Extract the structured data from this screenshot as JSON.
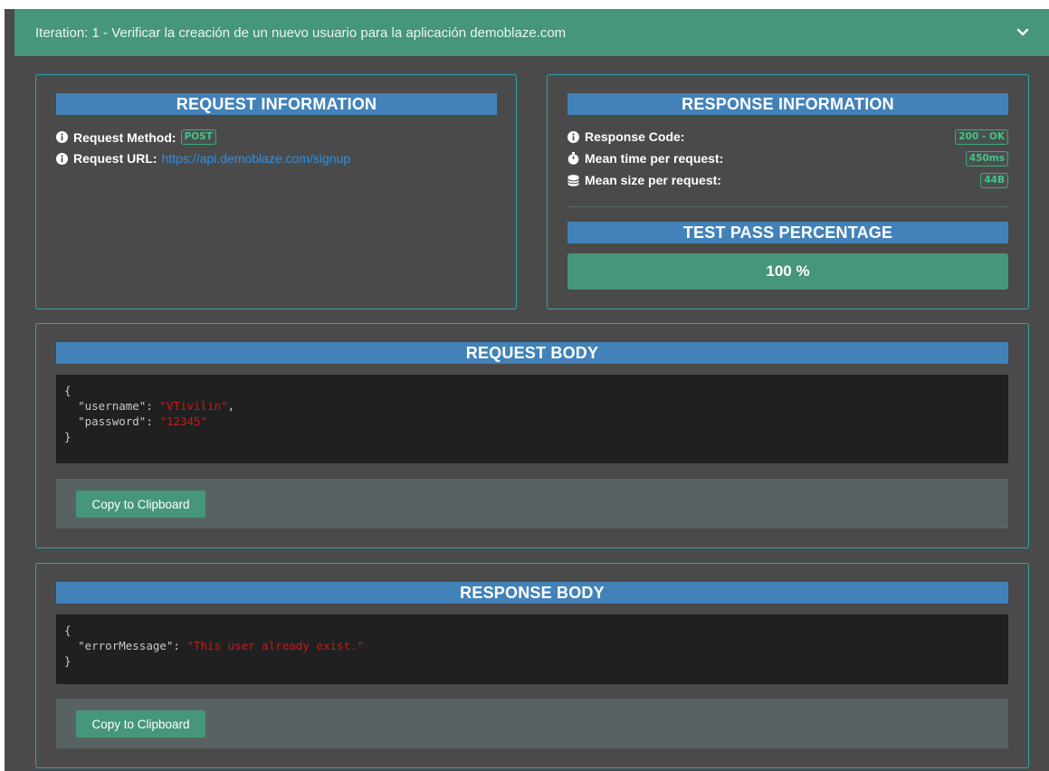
{
  "iteration": {
    "title": "Iteration: 1 - Verificar la creación de un nuevo usuario para la aplicación demoblaze.com",
    "toggle_icon": "chevron-down-icon"
  },
  "request_info": {
    "heading": "REQUEST INFORMATION",
    "method_label": "Request Method:",
    "method_value": "POST",
    "url_label": "Request URL:",
    "url_value": "https://api.demoblaze.com/signup"
  },
  "response_info": {
    "heading": "RESPONSE INFORMATION",
    "code_label": "Response Code:",
    "code_value": "200 - OK",
    "time_label": "Mean time per request:",
    "time_value": "450ms",
    "size_label": "Mean size per request:",
    "size_value": "44B"
  },
  "pass": {
    "heading": "TEST PASS PERCENTAGE",
    "value_text": "100 %",
    "percent": 100
  },
  "request_body": {
    "heading": "REQUEST BODY",
    "open": "{",
    "close": "}",
    "username_key": "\"username\"",
    "username_value": "\"VTivilin\"",
    "password_key": "\"password\"",
    "password_value": "\"12345\"",
    "copy_label": "Copy to Clipboard"
  },
  "response_body": {
    "heading": "RESPONSE BODY",
    "open": "{",
    "close": "}",
    "error_key": "\"errorMessage\"",
    "error_value": "\"This user already exist.\"",
    "copy_label": "Copy to Clipboard"
  },
  "colors": {
    "header_green": "#45967a",
    "section_blue": "#4282b8",
    "panel_border": "#2fa4b4",
    "background": "#4a4a4a",
    "code_string": "#d01818"
  }
}
